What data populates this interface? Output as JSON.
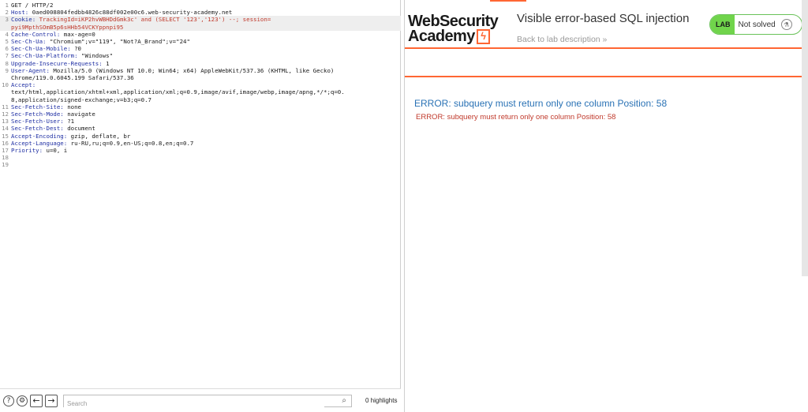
{
  "request": {
    "lines": [
      {
        "n": "1",
        "name": "GET / HTTP/2",
        "value": ""
      },
      {
        "n": "2",
        "name": "Host:",
        "value": " 0aed008804fedbb4826c88df002e00c6.web-security-academy.net"
      },
      {
        "n": "3",
        "name": "Cookie:",
        "value": " TrackingId=iKP2hvWBHDdGmk3c' and (SELECT '123','123') --; session=\npyi9MpthSOmB5p6sHHb54VCKYppnpi95",
        "highlight": true
      },
      {
        "n": "4",
        "name": "Cache-Control:",
        "value": " max-age=0"
      },
      {
        "n": "5",
        "name": "Sec-Ch-Ua:",
        "value": " \"Chromium\";v=\"119\", \"Not?A_Brand\";v=\"24\""
      },
      {
        "n": "6",
        "name": "Sec-Ch-Ua-Mobile:",
        "value": " ?0"
      },
      {
        "n": "7",
        "name": "Sec-Ch-Ua-Platform:",
        "value": " \"Windows\""
      },
      {
        "n": "8",
        "name": "Upgrade-Insecure-Requests:",
        "value": " 1"
      },
      {
        "n": "9",
        "name": "User-Agent:",
        "value": " Mozilla/5.0 (Windows NT 10.0; Win64; x64) AppleWebKit/537.36 (KHTML, like Gecko)\nChrome/119.0.6045.199 Safari/537.36"
      },
      {
        "n": "10",
        "name": "Accept:",
        "value": "\ntext/html,application/xhtml+xml,application/xml;q=0.9,image/avif,image/webp,image/apng,*/*;q=0.\n8,application/signed-exchange;v=b3;q=0.7"
      },
      {
        "n": "11",
        "name": "Sec-Fetch-Site:",
        "value": " none"
      },
      {
        "n": "12",
        "name": "Sec-Fetch-Mode:",
        "value": " navigate"
      },
      {
        "n": "13",
        "name": "Sec-Fetch-User:",
        "value": " ?1"
      },
      {
        "n": "14",
        "name": "Sec-Fetch-Dest:",
        "value": " document"
      },
      {
        "n": "15",
        "name": "Accept-Encoding:",
        "value": " gzip, deflate, br"
      },
      {
        "n": "16",
        "name": "Accept-Language:",
        "value": " ru-RU,ru;q=0.9,en-US;q=0.8,en;q=0.7"
      },
      {
        "n": "17",
        "name": "Priority:",
        "value": " u=0, i"
      },
      {
        "n": "18",
        "name": "",
        "value": ""
      },
      {
        "n": "19",
        "name": "",
        "value": ""
      }
    ]
  },
  "bottom_bar": {
    "help_icon": "?",
    "settings_icon": "⚙",
    "prev_icon": "←",
    "next_icon": "→",
    "search_placeholder": "Search",
    "search_value": "",
    "highlights_label": "0 highlights"
  },
  "lab": {
    "logo_line1": "WebSecurity",
    "logo_line2": "Academy",
    "logo_mark": "ϟ",
    "title": "Visible error-based SQL injection",
    "back_link": "Back to lab description  »",
    "badge_label": "LAB",
    "status": "Not solved",
    "accent_color": "#ff6633",
    "badge_color": "#70d44b"
  },
  "response": {
    "error_heading": "ERROR: subquery must return only one column Position: 58",
    "error_detail": "ERROR: subquery must return only one column Position: 58"
  }
}
